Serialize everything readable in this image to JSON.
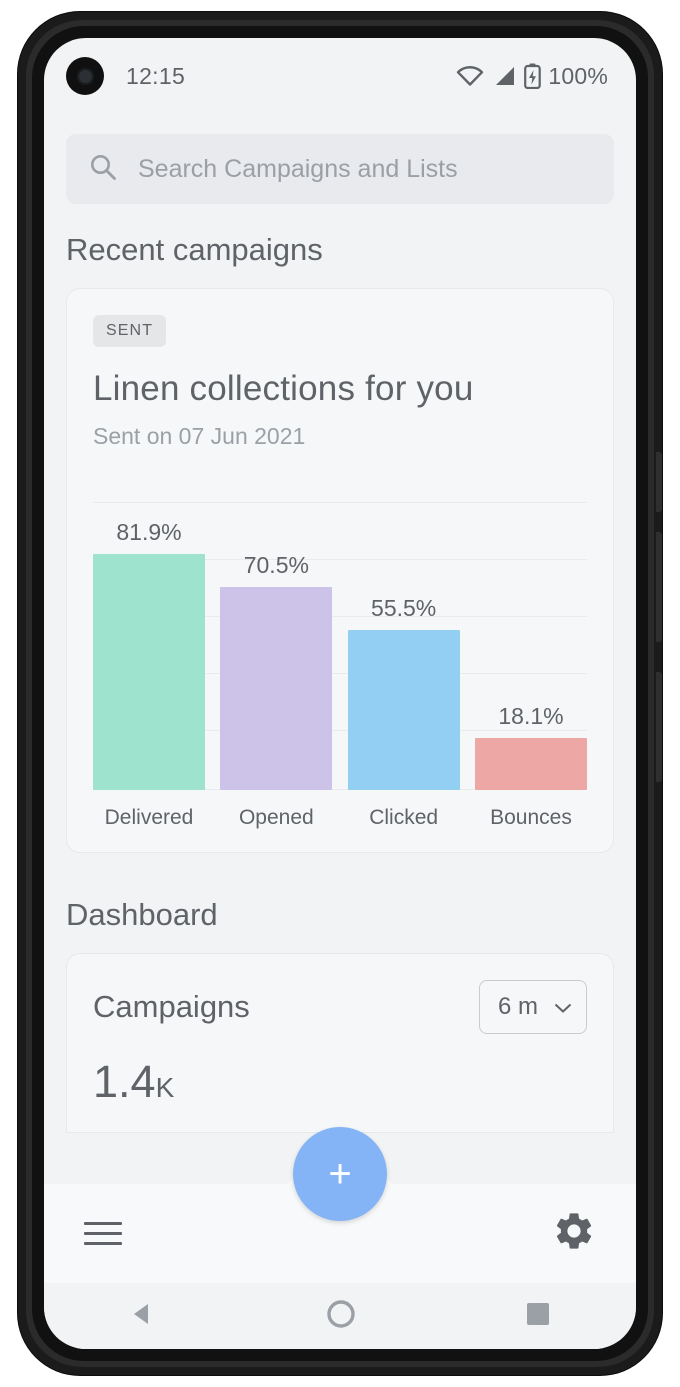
{
  "status_bar": {
    "time": "12:15",
    "battery_percent": "100%",
    "icons": [
      "wifi-icon",
      "signal-icon",
      "battery-icon"
    ]
  },
  "search": {
    "placeholder": "Search Campaigns and Lists",
    "icon": "search-icon"
  },
  "sections": {
    "recent_campaigns_title": "Recent campaigns",
    "dashboard_title": "Dashboard"
  },
  "campaign_card": {
    "status_badge": "SENT",
    "title": "Linen collections for you",
    "subtitle": "Sent on 07 Jun 2021"
  },
  "dashboard": {
    "label": "Campaigns",
    "range_value": "6 m",
    "range_caret_icon": "chevron-down-icon",
    "metric_value": "1.4",
    "metric_unit": "K"
  },
  "bottom_bar": {
    "menu_icon": "hamburger-menu-icon",
    "fab_icon": "plus-icon",
    "fab_label": "+",
    "settings_icon": "gear-icon"
  },
  "nav_bar": {
    "back_icon": "triangle-back-icon",
    "home_icon": "circle-home-icon",
    "recents_icon": "square-recents-icon"
  },
  "chart_data": {
    "type": "bar",
    "title": "",
    "categories": [
      "Delivered",
      "Opened",
      "Clicked",
      "Bounces"
    ],
    "values": [
      81.9,
      70.5,
      55.5,
      18.1
    ],
    "value_labels": [
      "81.9%",
      "70.5%",
      "55.5%",
      "18.1%"
    ],
    "colors": [
      "#9ee3cd",
      "#cdc3e8",
      "#93cff2",
      "#eda8a6"
    ],
    "ylim": [
      0,
      100
    ],
    "xlabel": "",
    "ylabel": "",
    "grid": true,
    "legend": "none"
  }
}
